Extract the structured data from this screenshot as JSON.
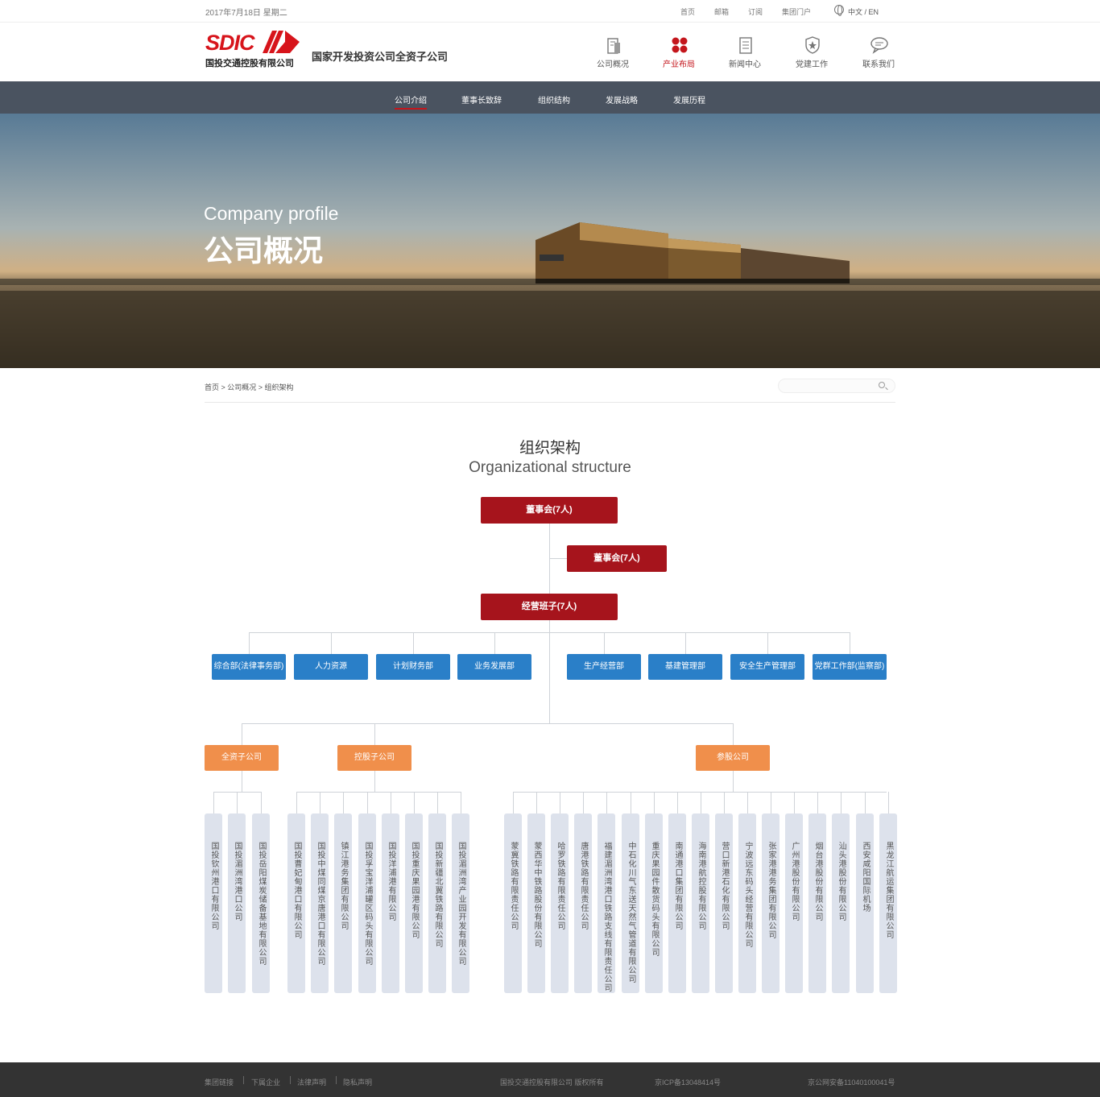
{
  "topbar": {
    "date": "2017年7月18日 星期二",
    "links": [
      "首页",
      "邮箱",
      "订阅",
      "集团门户"
    ],
    "language": "中文 / EN"
  },
  "header": {
    "logo_text": "SDIC",
    "logo_subtitle": "国投交通控股有限公司",
    "slogan": "国家开发投资公司全资子公司",
    "nav": [
      {
        "label": "公司概况",
        "icon": "building-icon"
      },
      {
        "label": "产业布局",
        "icon": "industry-layout-icon",
        "active": true
      },
      {
        "label": "新闻中心",
        "icon": "news-icon"
      },
      {
        "label": "党建工作",
        "icon": "party-badge-icon"
      },
      {
        "label": "联系我们",
        "icon": "chat-icon"
      }
    ]
  },
  "subnav": [
    "公司介绍",
    "董事长致辞",
    "组织结构",
    "发展战略",
    "发展历程"
  ],
  "banner": {
    "title_en": "Company profile",
    "title_cn": "公司概况"
  },
  "breadcrumb": "首页 > 公司概况 > 组织架构",
  "section": {
    "title_cn": "组织架构",
    "title_en": "Organizational structure"
  },
  "org": {
    "board": "董事会(7人)",
    "supervisory": "董事会(7人)",
    "management": "经营班子(7人)",
    "departments": [
      "综合部(法律事务部)",
      "人力资源",
      "计划财务部",
      "业务发展部",
      "生产经营部",
      "基建管理部",
      "安全生产管理部",
      "党群工作部(监察部)"
    ],
    "categories": [
      "全资子公司",
      "控股子公司",
      "参股公司"
    ],
    "wholly_owned": [
      "国投钦州港口有限公司",
      "国投湄洲湾港口公司",
      "国投岳阳煤炭储备基地有限公司"
    ],
    "holding": [
      "国投曹妃甸港口有限公司",
      "国投中煤同煤京唐港口有限公司",
      "镇江港务集团有限公司",
      "国投孚宝洋浦罐区码头有限公司",
      "国投洋浦港有限公司",
      "国投重庆果园港有限公司",
      "国投新疆北翼铁路有限公司",
      "国投湄洲湾产业园开发有限公司"
    ],
    "participating": [
      "蒙冀铁路有限责任公司",
      "蒙西华中铁路股份有限公司",
      "哈罗铁路有限责任公司",
      "唐港铁路有限责任公司",
      "福建湄洲湾港口铁路支线有限责任公司",
      "中石化川气东送天然气管道有限公司",
      "重庆果园件散货码头有限公司",
      "南通港口集团有限公司",
      "海南港航控股有限公司",
      "营口新港石化有限公司",
      "宁波远东码头经营有限公司",
      "张家港港务集团有限公司",
      "广州港股份有限公司",
      "烟台港股份有限公司",
      "汕头港股份有限公司",
      "西安咸阳国际机场",
      "黑龙江航运集团有限公司"
    ]
  },
  "footer": {
    "links": [
      "集团链接",
      "下属企业",
      "法律声明",
      "隐私声明"
    ],
    "copyright": "国投交通控股有限公司 版权所有",
    "icp": "京ICP备13048414号",
    "police": "京公网安备11040100041号"
  }
}
